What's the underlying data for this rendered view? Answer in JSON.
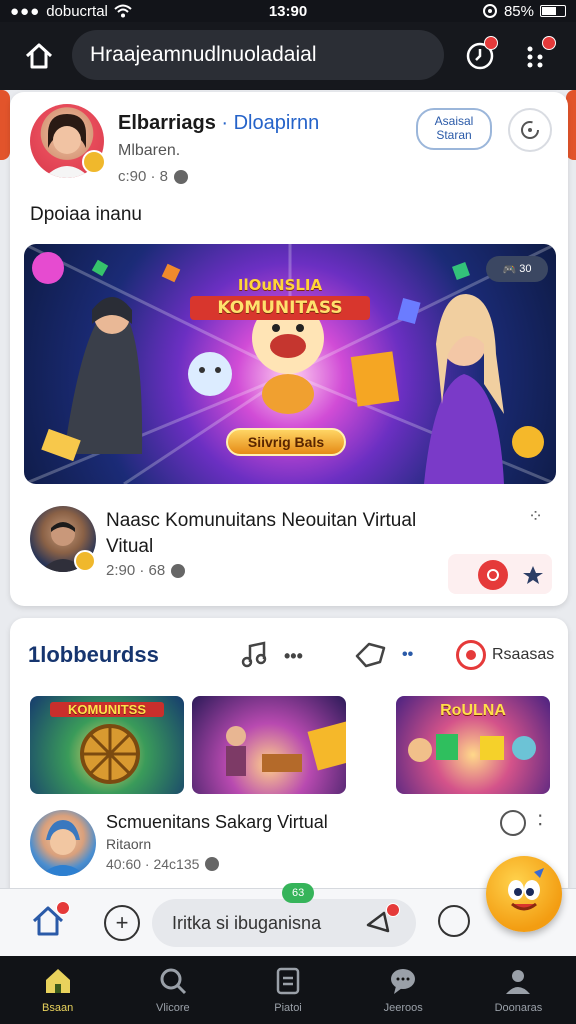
{
  "status_bar": {
    "carrier": "dobucrtal",
    "time": "13:90",
    "battery": "85%"
  },
  "top_bar": {
    "search_text": "Hraajeamnudlnuoladaial"
  },
  "post1": {
    "author": "Elbarriags",
    "group": "Dloapirnn",
    "subtitle": "Mlbaren.",
    "meta": "c:90 · 8",
    "join_button": "Asaisal Staran",
    "caption": "Dpoiaa inanu",
    "banner": {
      "title_line1": "IlOuNSLIA",
      "title_line2": "KOMUNITASS",
      "cta": "Siivrig Bals",
      "chip": "30"
    }
  },
  "post2": {
    "title": "Naasc Komunuitans Neouitan Virtual",
    "title_line2": "Vitual",
    "meta": "2:90 · 68"
  },
  "section": {
    "title": "1lobbeurdss",
    "action_label": "Rsaasas",
    "thumbs": [
      {
        "label": "KOMUNITSS"
      },
      {
        "label": ""
      },
      {
        "label": "RoULNA"
      }
    ]
  },
  "post3": {
    "title": "Scmuenitans Sakarg Virtual",
    "subtitle": "Ritaorn",
    "meta": "40:60 · 24c135"
  },
  "composer": {
    "placeholder": "Iritka si ibuganisna",
    "badge": "63"
  },
  "nav": {
    "items": [
      {
        "label": "Bsaan",
        "icon": "home-icon"
      },
      {
        "label": "Vlicore",
        "icon": "search-icon"
      },
      {
        "label": "Piatoi",
        "icon": "document-icon"
      },
      {
        "label": "Jeeroos",
        "icon": "chat-icon"
      },
      {
        "label": "Doonaras",
        "icon": "profile-icon"
      }
    ]
  },
  "colors": {
    "accent_blue": "#2563c9",
    "badge_red": "#e53a3a",
    "nav_active": "#e8d25c",
    "dark_bg": "#16181d"
  }
}
